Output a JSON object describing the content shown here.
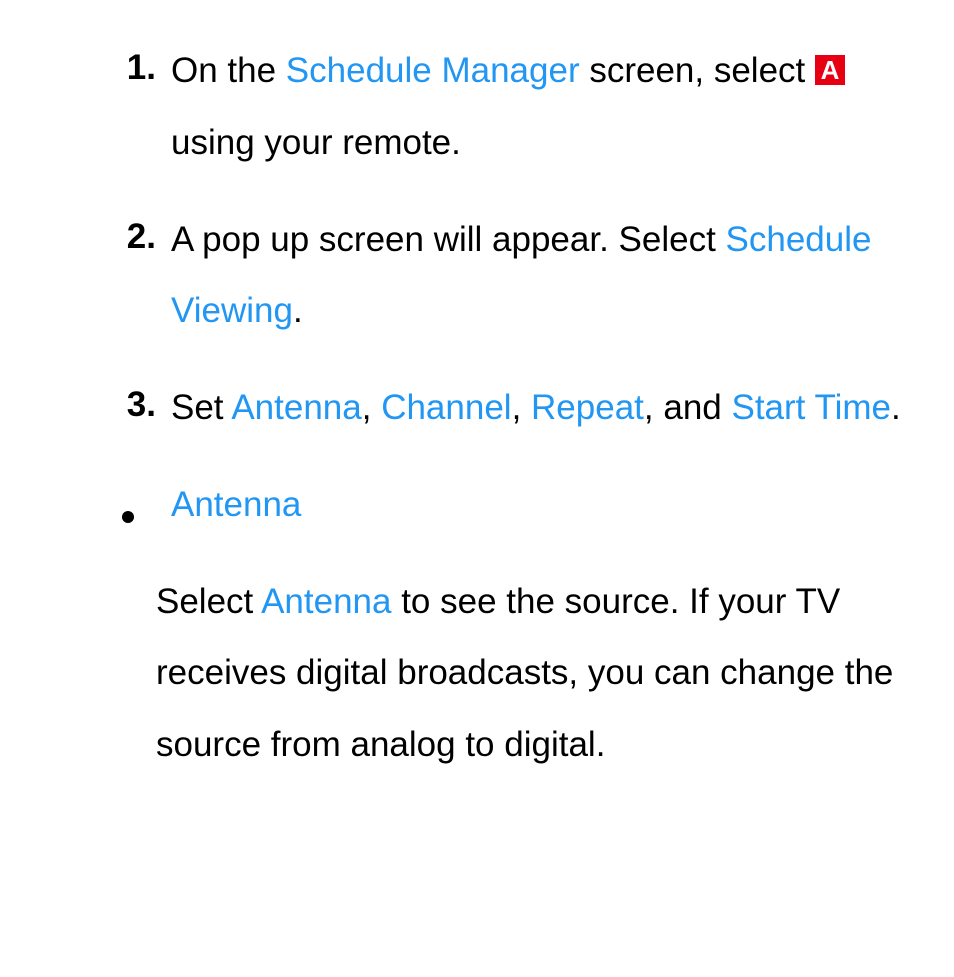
{
  "steps": [
    {
      "marker": "1.",
      "parts": [
        {
          "text": "On the "
        },
        {
          "text": "Schedule Manager",
          "accent": true
        },
        {
          "text": " screen, select "
        },
        {
          "button": "A"
        },
        {
          "text": " using your remote."
        }
      ]
    },
    {
      "marker": "2.",
      "parts": [
        {
          "text": "A pop up screen will appear. Select "
        },
        {
          "text": "Schedule Viewing",
          "accent": true
        },
        {
          "text": "."
        }
      ]
    },
    {
      "marker": "3.",
      "parts": [
        {
          "text": "Set "
        },
        {
          "text": "Antenna",
          "accent": true
        },
        {
          "text": ", "
        },
        {
          "text": "Channel",
          "accent": true
        },
        {
          "text": ", "
        },
        {
          "text": "Repeat",
          "accent": true
        },
        {
          "text": ", and "
        },
        {
          "text": "Start Time",
          "accent": true
        },
        {
          "text": "."
        }
      ]
    }
  ],
  "bullet": {
    "title": "Antenna",
    "body_parts": [
      {
        "text": "Select "
      },
      {
        "text": "Antenna",
        "accent": true
      },
      {
        "text": " to see the source. If your TV receives digital broadcasts, you can change the source from analog to digital."
      }
    ]
  },
  "remote_button_color": "#e60012",
  "accent_color": "#2196f3"
}
